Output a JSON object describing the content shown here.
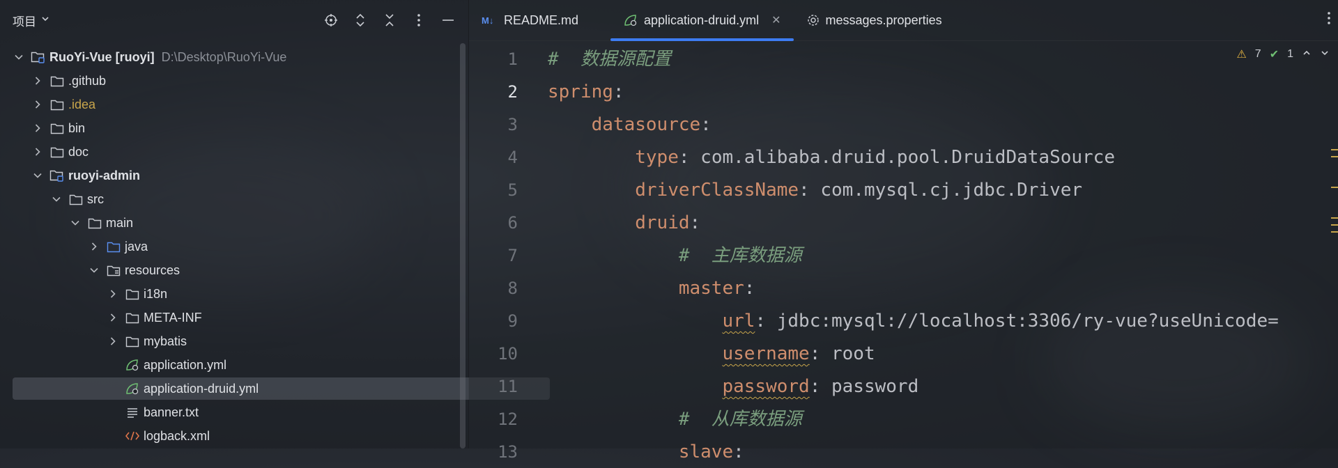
{
  "project_panel": {
    "title": "项目",
    "tree": [
      {
        "label": "RuoYi-Vue [ruoyi]",
        "suffix": "D:\\Desktop\\RuoYi-Vue",
        "depth": 0,
        "expanded": true,
        "icon": "module-folder-icon"
      },
      {
        "label": ".github",
        "depth": 1,
        "expanded": false,
        "icon": "folder-icon"
      },
      {
        "label": ".idea",
        "depth": 1,
        "expanded": false,
        "icon": "folder-icon"
      },
      {
        "label": "bin",
        "depth": 1,
        "expanded": false,
        "icon": "folder-icon"
      },
      {
        "label": "doc",
        "depth": 1,
        "expanded": false,
        "icon": "folder-icon"
      },
      {
        "label": "ruoyi-admin",
        "depth": 1,
        "expanded": true,
        "icon": "module-folder-icon"
      },
      {
        "label": "src",
        "depth": 2,
        "expanded": true,
        "icon": "folder-icon"
      },
      {
        "label": "main",
        "depth": 3,
        "expanded": true,
        "icon": "folder-icon"
      },
      {
        "label": "java",
        "depth": 4,
        "expanded": false,
        "icon": "source-folder-icon"
      },
      {
        "label": "resources",
        "depth": 4,
        "expanded": true,
        "icon": "resources-folder-icon"
      },
      {
        "label": "i18n",
        "depth": 5,
        "expanded": false,
        "icon": "folder-icon"
      },
      {
        "label": "META-INF",
        "depth": 5,
        "expanded": false,
        "icon": "folder-icon"
      },
      {
        "label": "mybatis",
        "depth": 5,
        "expanded": false,
        "icon": "folder-icon"
      },
      {
        "label": "application.yml",
        "depth": 5,
        "icon": "spring-yml-icon"
      },
      {
        "label": "application-druid.yml",
        "depth": 5,
        "icon": "spring-yml-icon",
        "selected": true
      },
      {
        "label": "banner.txt",
        "depth": 5,
        "icon": "text-file-icon"
      },
      {
        "label": "logback.xml",
        "depth": 5,
        "icon": "xml-file-icon"
      }
    ]
  },
  "tabs": [
    {
      "label": "README.md",
      "icon": "markdown-icon"
    },
    {
      "label": "application-druid.yml",
      "icon": "spring-yml-icon",
      "active": true
    },
    {
      "label": "messages.properties",
      "icon": "gear-icon"
    }
  ],
  "inspections": {
    "warnings": "7",
    "ok": "1"
  },
  "code_lines": [
    {
      "n": "1",
      "segments": [
        {
          "t": "#  数据源配置",
          "c": "c"
        }
      ]
    },
    {
      "n": "2",
      "segments": [
        {
          "t": "spring",
          "c": "k"
        },
        {
          "t": ":",
          "c": "p"
        }
      ]
    },
    {
      "n": "3",
      "segments": [
        {
          "t": "    "
        },
        {
          "t": "datasource",
          "c": "k"
        },
        {
          "t": ":",
          "c": "p"
        }
      ]
    },
    {
      "n": "4",
      "segments": [
        {
          "t": "        "
        },
        {
          "t": "type",
          "c": "k"
        },
        {
          "t": ": com.alibaba.druid.pool.DruidDataSource",
          "c": "v"
        }
      ]
    },
    {
      "n": "5",
      "segments": [
        {
          "t": "        "
        },
        {
          "t": "driverClassName",
          "c": "k"
        },
        {
          "t": ": com.mysql.cj.jdbc.Driver",
          "c": "v"
        }
      ]
    },
    {
      "n": "6",
      "segments": [
        {
          "t": "        "
        },
        {
          "t": "druid",
          "c": "k"
        },
        {
          "t": ":",
          "c": "p"
        }
      ]
    },
    {
      "n": "7",
      "segments": [
        {
          "t": "            "
        },
        {
          "t": "#  主库数据源",
          "c": "c"
        }
      ]
    },
    {
      "n": "8",
      "segments": [
        {
          "t": "            "
        },
        {
          "t": "master",
          "c": "k"
        },
        {
          "t": ":",
          "c": "p"
        }
      ]
    },
    {
      "n": "9",
      "segments": [
        {
          "t": "                "
        },
        {
          "t": "url",
          "c": "k squig"
        },
        {
          "t": ": jdbc:mysql://localhost:3306/ry-vue?useUnicode=",
          "c": "v"
        }
      ]
    },
    {
      "n": "10",
      "segments": [
        {
          "t": "                "
        },
        {
          "t": "username",
          "c": "k squig"
        },
        {
          "t": ": root",
          "c": "v"
        }
      ]
    },
    {
      "n": "11",
      "segments": [
        {
          "t": "                "
        },
        {
          "t": "password",
          "c": "k squig"
        },
        {
          "t": ": password",
          "c": "v"
        }
      ]
    },
    {
      "n": "12",
      "segments": [
        {
          "t": "            "
        },
        {
          "t": "#  从库数据源",
          "c": "c"
        }
      ]
    },
    {
      "n": "13",
      "segments": [
        {
          "t": "            "
        },
        {
          "t": "slave",
          "c": "k"
        },
        {
          "t": ":",
          "c": "p"
        }
      ]
    }
  ],
  "current_line": "2"
}
